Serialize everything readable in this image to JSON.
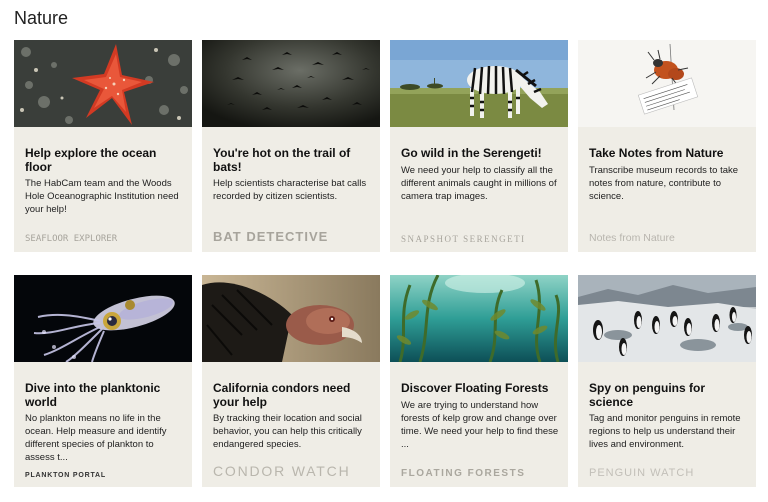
{
  "section": {
    "title": "Nature"
  },
  "cards": [
    {
      "title": "Help explore the ocean floor",
      "desc": "The HabCam team and the Woods Hole Oceanographic Institution need your help!",
      "brand": "SEAFLOOR EXPLORER"
    },
    {
      "title": "You're hot on the trail of bats!",
      "desc": "Help scientists characterise bat calls recorded by citizen scientists.",
      "brand": "BAT DETECTIVE"
    },
    {
      "title": "Go wild in the Serengeti!",
      "desc": "We need your help to classify all the different animals caught in millions of camera trap images.",
      "brand": "SNAPSHOT SERENGETI"
    },
    {
      "title": "Take Notes from Nature",
      "desc": "Transcribe museum records to take notes from nature, contribute to science.",
      "brand": "Notes from Nature"
    },
    {
      "title": "Dive into the planktonic world",
      "desc": "No plankton means no life in the ocean. Help measure and identify different species of plankton to assess t...",
      "brand": "PLANKTON PORTAL"
    },
    {
      "title": "California condors need your help",
      "desc": "By tracking their location and social behavior, you can help this critically endangered species.",
      "brand": "CONDOR WATCH"
    },
    {
      "title": "Discover Floating Forests",
      "desc": "We are trying to understand how forests of kelp grow and change over time. We need your help to find these ...",
      "brand": "FLOATING FORESTS"
    },
    {
      "title": "Spy on penguins for science",
      "desc": "Tag and monitor penguins in remote regions to help us understand their lives and environment.",
      "brand": "PENGUIN WATCH"
    }
  ]
}
